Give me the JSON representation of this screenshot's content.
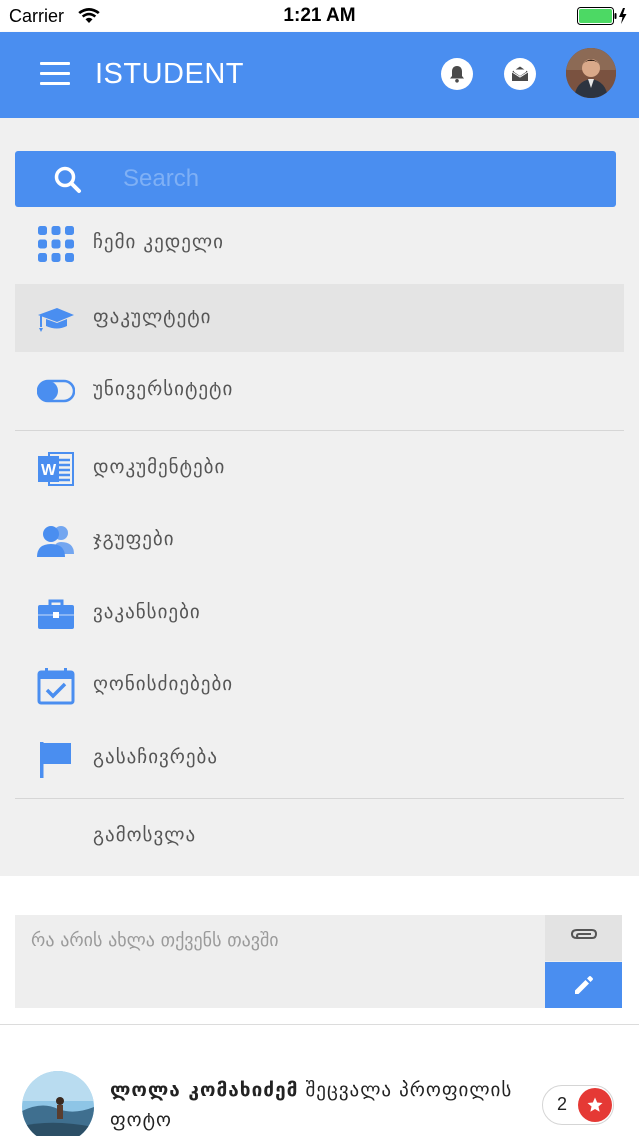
{
  "status_bar": {
    "carrier": "Carrier",
    "time": "1:21 AM"
  },
  "header": {
    "title": "ISTUDENT",
    "accent_color": "#4a8ef0"
  },
  "search": {
    "placeholder": "Search"
  },
  "menu": {
    "items": [
      {
        "label": "ჩემი კედელი",
        "icon": "grid-icon"
      },
      {
        "label": "ფაკულტეტი",
        "icon": "graduation-cap-icon"
      },
      {
        "label": "უნივერსიტეტი",
        "icon": "toggle-icon"
      },
      {
        "label": "დოკუმენტები",
        "icon": "word-document-icon"
      },
      {
        "label": "ჯგუფები",
        "icon": "users-icon"
      },
      {
        "label": "ვაკანსიები",
        "icon": "briefcase-icon"
      },
      {
        "label": "ღონისძიებები",
        "icon": "calendar-check-icon"
      },
      {
        "label": "გასაჩივრება",
        "icon": "flag-icon"
      }
    ],
    "logout_label": "გამოსვლა",
    "active_index": 1
  },
  "composer": {
    "placeholder": "რა არის ახლა თქვენს თავში"
  },
  "feed": {
    "items": [
      {
        "author": "ლოლა კომახიძემ",
        "action": " შეცვალა პროფილის ფოტო",
        "likes": "2"
      }
    ]
  }
}
